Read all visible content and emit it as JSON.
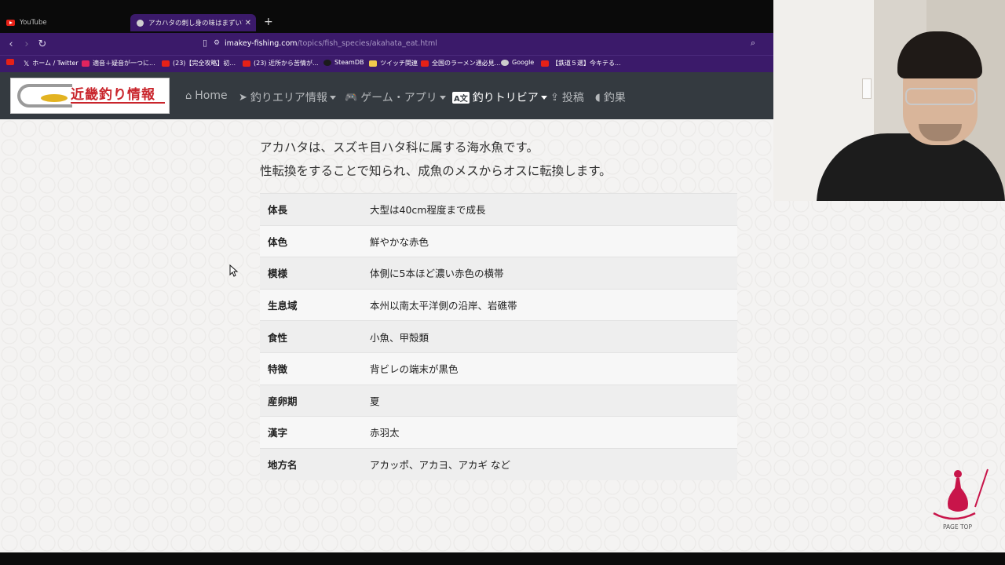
{
  "browser": {
    "tabs": [
      {
        "title": "YouTube",
        "active": false
      },
      {
        "title": "アカハタの刺し身の味はまずい？釣っ",
        "active": true
      }
    ],
    "new_tab": "+",
    "url_host": "imakey-fishing.com",
    "url_path": "/topics/fish_species/akahata_eat.html",
    "bookmarks": [
      {
        "label": "ホーム / Twitter",
        "icon_color": "#000000"
      },
      {
        "label": "適音＋疑音が一つに...",
        "icon_color": "#e0245e"
      },
      {
        "label": "(23)【完全攻略】初...",
        "icon_color": "#e62117"
      },
      {
        "label": "(23) 近所から苦情が...",
        "icon_color": "#e62117"
      },
      {
        "label": "SteamDB",
        "icon_color": "#1b1b1b"
      },
      {
        "label": "ツイッチ関連",
        "icon_color": "#f2c94c"
      },
      {
        "label": "全国のラーメン通必見...",
        "icon_color": "#e62117"
      },
      {
        "label": "Google",
        "icon_color": "#cccccc"
      },
      {
        "label": "【鉄道５選】今キテる...",
        "icon_color": "#e62117"
      }
    ]
  },
  "site": {
    "logo_text": "近畿釣り情報",
    "nav": [
      {
        "label": "Home",
        "icon": "home-icon",
        "dropdown": false,
        "active": false
      },
      {
        "label": "釣りエリア情報",
        "icon": "location-arrow-icon",
        "dropdown": true,
        "active": false
      },
      {
        "label": "ゲーム・アプリ",
        "icon": "gamepad-icon",
        "dropdown": true,
        "active": false
      },
      {
        "label": "釣りトリビア",
        "icon": "language-icon",
        "dropdown": true,
        "active": true
      },
      {
        "label": "投稿",
        "icon": "upload-icon",
        "dropdown": false,
        "active": false
      },
      {
        "label": "釣果",
        "icon": "fish-icon",
        "dropdown": false,
        "active": false
      }
    ]
  },
  "content": {
    "intro_line1": "アカハタは、スズキ目ハタ科に属する海水魚です。",
    "intro_line2": "性転換をすることで知られ、成魚のメスからオスに転換します。",
    "table": [
      {
        "key": "体長",
        "value": "大型は40cm程度まで成長"
      },
      {
        "key": "体色",
        "value": "鮮やかな赤色"
      },
      {
        "key": "模様",
        "value": "体側に5本ほど濃い赤色の横帯"
      },
      {
        "key": "生息域",
        "value": "本州以南太平洋側の沿岸、岩礁帯"
      },
      {
        "key": "食性",
        "value": "小魚、甲殻類"
      },
      {
        "key": "特徴",
        "value": "背ビレの端末が黒色"
      },
      {
        "key": "産卵期",
        "value": "夏"
      },
      {
        "key": "漢字",
        "value": "赤羽太"
      },
      {
        "key": "地方名",
        "value": "アカッポ、アカヨ、アカギ など"
      }
    ]
  },
  "page_top": {
    "label": "PAGE TOP",
    "color": "#c8154a"
  },
  "colors": {
    "chrome_purple": "#3b1a6a",
    "header_dark": "#343a40",
    "logo_red": "#c9252c"
  }
}
